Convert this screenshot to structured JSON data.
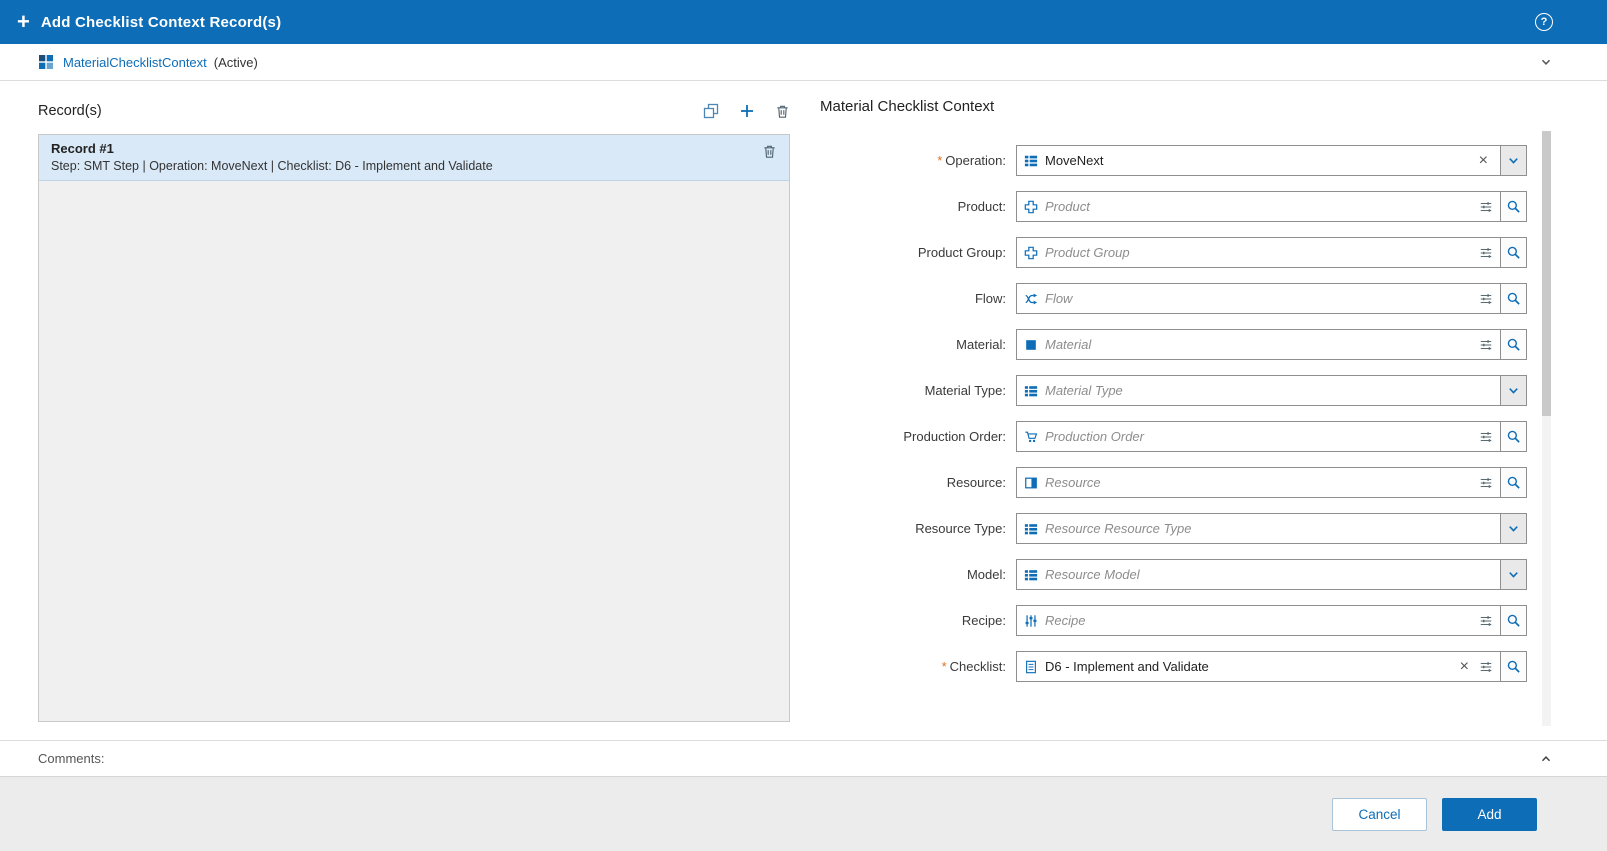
{
  "colors": {
    "brand": "#0d6db7",
    "required": "#e2711d",
    "selected_record_bg": "#d9e9f7",
    "list_bg": "#f0f0f0",
    "footer_bg": "#ececec"
  },
  "header": {
    "title": "Add Checklist Context Record(s)"
  },
  "context_bar": {
    "entity_name": "MaterialChecklistContext",
    "status": "(Active)"
  },
  "records_panel": {
    "title": "Record(s)",
    "records": [
      {
        "title": "Record #1",
        "subtitle": "Step: SMT Step | Operation: MoveNext | Checklist: D6 - Implement and Validate"
      }
    ]
  },
  "form": {
    "title": "Material Checklist Context",
    "rows": [
      {
        "key": "operation",
        "label": "Operation:",
        "required": true,
        "icon": "operation-icon",
        "text": "MoveNext",
        "is_placeholder": false,
        "clear": true,
        "filter": false,
        "button": "dropdown"
      },
      {
        "key": "product",
        "label": "Product:",
        "required": false,
        "icon": "product-icon",
        "text": "Product",
        "is_placeholder": true,
        "clear": false,
        "filter": true,
        "button": "search"
      },
      {
        "key": "product-group",
        "label": "Product Group:",
        "required": false,
        "icon": "product-group-icon",
        "text": "Product Group",
        "is_placeholder": true,
        "clear": false,
        "filter": true,
        "button": "search"
      },
      {
        "key": "flow",
        "label": "Flow:",
        "required": false,
        "icon": "flow-icon",
        "text": "Flow",
        "is_placeholder": true,
        "clear": false,
        "filter": true,
        "button": "search"
      },
      {
        "key": "material",
        "label": "Material:",
        "required": false,
        "icon": "material-icon",
        "text": "Material",
        "is_placeholder": true,
        "clear": false,
        "filter": true,
        "button": "search"
      },
      {
        "key": "material-type",
        "label": "Material Type:",
        "required": false,
        "icon": "material-type-icon",
        "text": "Material Type",
        "is_placeholder": true,
        "clear": false,
        "filter": false,
        "button": "dropdown"
      },
      {
        "key": "production-order",
        "label": "Production Order:",
        "required": false,
        "icon": "production-order-icon",
        "text": "Production Order",
        "is_placeholder": true,
        "clear": false,
        "filter": true,
        "button": "search"
      },
      {
        "key": "resource",
        "label": "Resource:",
        "required": false,
        "icon": "resource-icon",
        "text": "Resource",
        "is_placeholder": true,
        "clear": false,
        "filter": true,
        "button": "search"
      },
      {
        "key": "resource-type",
        "label": "Resource Type:",
        "required": false,
        "icon": "resource-type-icon",
        "text": "Resource Resource Type",
        "is_placeholder": true,
        "clear": false,
        "filter": false,
        "button": "dropdown"
      },
      {
        "key": "model",
        "label": "Model:",
        "required": false,
        "icon": "model-icon",
        "text": "Resource Model",
        "is_placeholder": true,
        "clear": false,
        "filter": false,
        "button": "dropdown"
      },
      {
        "key": "recipe",
        "label": "Recipe:",
        "required": false,
        "icon": "recipe-icon",
        "text": "Recipe",
        "is_placeholder": true,
        "clear": false,
        "filter": true,
        "button": "search"
      },
      {
        "key": "checklist",
        "label": "Checklist:",
        "required": true,
        "icon": "checklist-icon",
        "text": "D6 - Implement and Validate",
        "is_placeholder": false,
        "clear": true,
        "filter": true,
        "button": "search"
      }
    ]
  },
  "comments": {
    "label": "Comments:"
  },
  "footer": {
    "cancel_label": "Cancel",
    "add_label": "Add"
  }
}
